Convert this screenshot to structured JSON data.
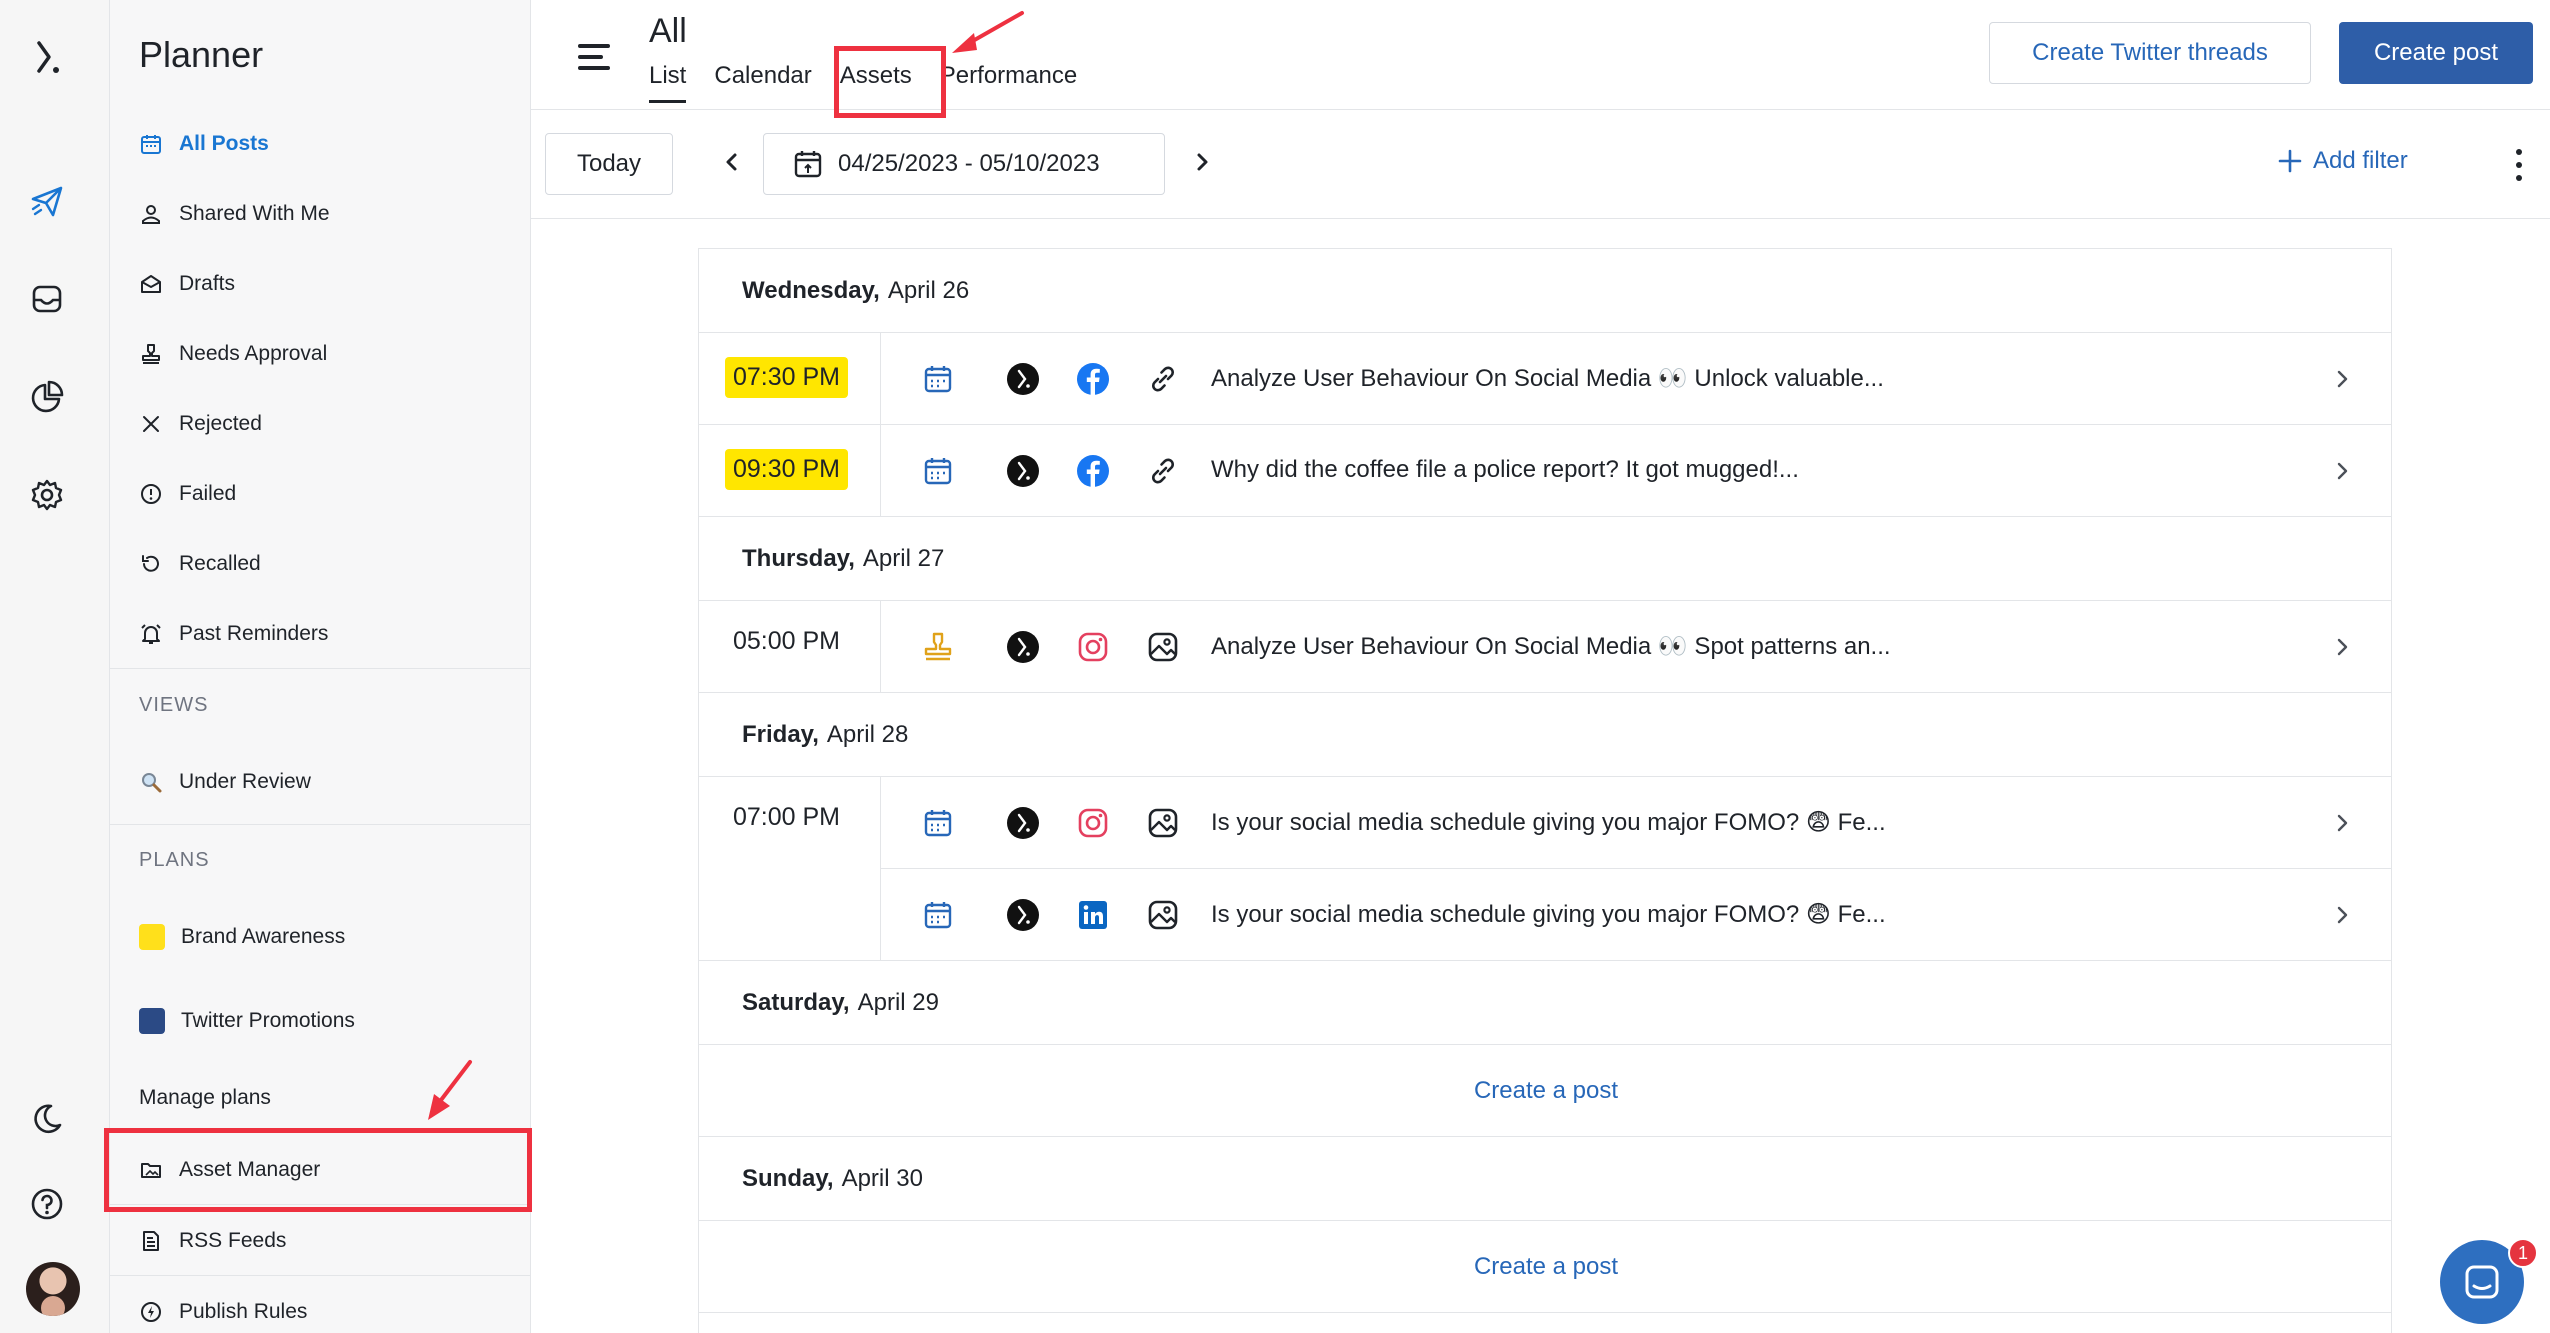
{
  "sidebar": {
    "title": "Planner",
    "items": [
      {
        "label": "All Posts",
        "icon": "calendar-icon"
      },
      {
        "label": "Shared With Me",
        "icon": "person-icon"
      },
      {
        "label": "Drafts",
        "icon": "drafts-icon"
      },
      {
        "label": "Needs Approval",
        "icon": "stamp-icon"
      },
      {
        "label": "Rejected",
        "icon": "x-icon"
      },
      {
        "label": "Failed",
        "icon": "alert-circle-icon"
      },
      {
        "label": "Recalled",
        "icon": "undo-icon"
      },
      {
        "label": "Past Reminders",
        "icon": "alarm-icon"
      }
    ],
    "views_heading": "VIEWS",
    "views": [
      {
        "label": "Under Review",
        "icon": "magnifier-icon"
      }
    ],
    "plans_heading": "PLANS",
    "plans": [
      {
        "label": "Brand Awareness",
        "color": "#ffe01b"
      },
      {
        "label": "Twitter Promotions",
        "color": "#2b4a85"
      }
    ],
    "manage_plans": "Manage plans",
    "tools": [
      {
        "label": "Asset Manager",
        "icon": "folder-image-icon"
      },
      {
        "label": "RSS Feeds",
        "icon": "rss-doc-icon"
      },
      {
        "label": "Publish Rules",
        "icon": "bolt-circle-icon"
      }
    ]
  },
  "header": {
    "title": "All",
    "tabs": [
      "List",
      "Calendar",
      "Assets",
      "Performance"
    ],
    "active_tab": "List",
    "create_threads": "Create Twitter threads",
    "create_post": "Create post"
  },
  "toolbar": {
    "today": "Today",
    "date_range": "04/25/2023 - 05/10/2023",
    "add_filter": "Add filter"
  },
  "days": [
    {
      "weekday": "Wednesday,",
      "date": "April 26",
      "posts": [
        {
          "time": "07:30 PM",
          "highlight": true,
          "status_icon": "calendar-icon",
          "network": "facebook",
          "type_icon": "link-icon",
          "text": "Analyze User Behaviour On Social Media 👀 Unlock valuable..."
        },
        {
          "time": "09:30 PM",
          "highlight": true,
          "status_icon": "calendar-icon",
          "network": "facebook",
          "type_icon": "link-icon",
          "text": "Why did the coffee file a police report? It got mugged!..."
        }
      ]
    },
    {
      "weekday": "Thursday,",
      "date": "April 27",
      "posts": [
        {
          "time": "05:00 PM",
          "highlight": false,
          "status_icon": "stamp-icon",
          "network": "instagram",
          "type_icon": "image-icon",
          "text": "Analyze User Behaviour On Social Media 👀 Spot patterns an..."
        }
      ]
    },
    {
      "weekday": "Friday,",
      "date": "April 28",
      "posts": [
        {
          "time": "07:00 PM",
          "highlight": false,
          "status_icon": "calendar-icon",
          "network": "instagram",
          "type_icon": "image-icon",
          "text": "Is your social media schedule giving you major FOMO? 😨 Fe..."
        },
        {
          "time": "",
          "highlight": false,
          "status_icon": "calendar-icon",
          "network": "linkedin",
          "type_icon": "image-icon",
          "text": "Is your social media schedule giving you major FOMO? 😨 Fe..."
        }
      ]
    },
    {
      "weekday": "Saturday,",
      "date": "April 29",
      "create": "Create a post"
    },
    {
      "weekday": "Sunday,",
      "date": "April 30",
      "create": "Create a post"
    }
  ],
  "chat": {
    "badge": "1"
  },
  "colors": {
    "accent": "#1976d2",
    "primary_button": "#2e5ea8",
    "highlight": "#ffe600",
    "annotation": "#ee3140"
  }
}
